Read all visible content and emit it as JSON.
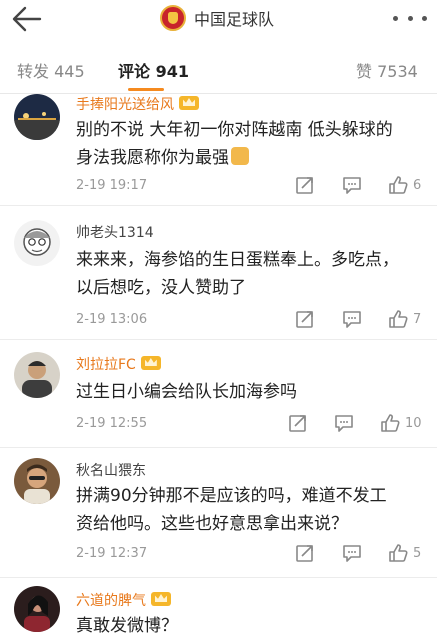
{
  "header": {
    "title": "中国足球队"
  },
  "tabs": [
    {
      "label": "转发 445"
    },
    {
      "label": "评论 941"
    },
    {
      "label": "赞 7534"
    }
  ],
  "comments": [
    {
      "user": "手捧阳光送给风",
      "text_lines": [
        "别的不说 大年初一你对阵越南 低头躲球的",
        "身法我愿称你为最强"
      ],
      "time": "2-19 19:17",
      "likes": "6"
    },
    {
      "user": "帅老头1314",
      "text_lines": [
        "来来来，海参馅的生日蛋糕奉上。多吃点，",
        "以后想吃，没人赞助了"
      ],
      "time": "2-19 13:06",
      "likes": "7"
    },
    {
      "user": "刘拉拉FC",
      "text_lines": [
        "过生日小编会给队长加海参吗"
      ],
      "time": "2-19 12:55",
      "likes": "10"
    },
    {
      "user": "秋名山猥东",
      "text_lines": [
        "拼满90分钟那不是应该的吗，难道不发工",
        "资给他吗。这些也好意思拿出来说？"
      ],
      "time": "2-19 12:37",
      "likes": "5"
    },
    {
      "user": "六道的脾气",
      "text_lines": [
        "真敢发微博？"
      ],
      "time": "",
      "likes": ""
    }
  ],
  "colors": {
    "accent": "#f58a1f",
    "vip_name": "#e8791c"
  }
}
